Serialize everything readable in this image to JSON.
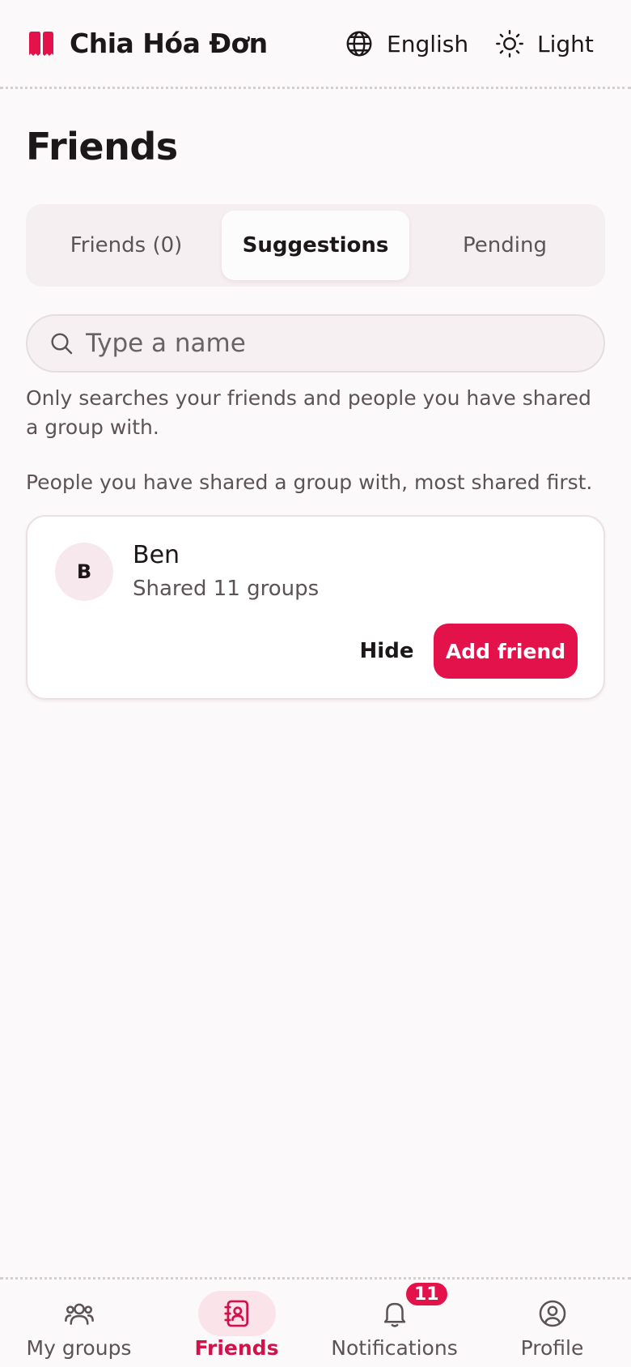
{
  "header": {
    "app_name": "Chia Hóa Đơn",
    "language_label": "English",
    "theme_label": "Light",
    "brand_color": "#e3124b"
  },
  "page": {
    "title": "Friends"
  },
  "tabs": [
    {
      "label": "Friends (0)",
      "active": false
    },
    {
      "label": "Suggestions",
      "active": true
    },
    {
      "label": "Pending",
      "active": false
    }
  ],
  "search": {
    "placeholder": "Type a name",
    "value": ""
  },
  "help_text": "Only searches your friends and people you have shared a group with.",
  "suggestions_caption": "People you have shared a group with, most shared first.",
  "suggestions": [
    {
      "initial": "B",
      "name": "Ben",
      "subtitle": "Shared 11 groups",
      "hide_label": "Hide",
      "add_label": "Add friend"
    }
  ],
  "nav": {
    "items": [
      {
        "label": "My groups",
        "icon": "users-icon",
        "active": false
      },
      {
        "label": "Friends",
        "icon": "contact-book-icon",
        "active": true
      },
      {
        "label": "Notifications",
        "icon": "bell-icon",
        "active": false,
        "badge": "11"
      },
      {
        "label": "Profile",
        "icon": "user-circle-icon",
        "active": false
      }
    ]
  }
}
